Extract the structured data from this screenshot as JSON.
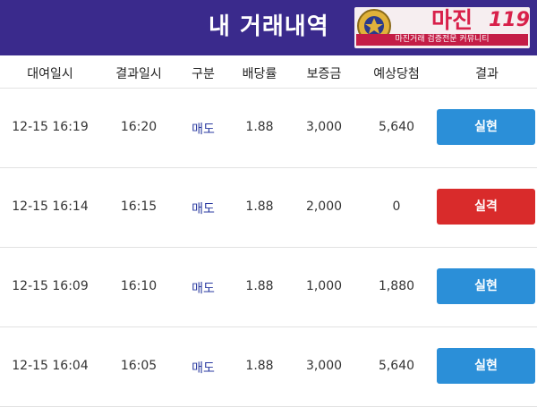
{
  "header": {
    "title": "내 거래내역",
    "logo": {
      "main": "마진",
      "number": "119",
      "tagline": "마진거래 검증전문 커뮤니티"
    }
  },
  "columns": [
    "대여일시",
    "결과일시",
    "구분",
    "배당률",
    "보증금",
    "예상당첨",
    "결과"
  ],
  "rows": [
    {
      "rent_time": "12-15 16:19",
      "result_time": "16:20",
      "type": "매도",
      "odds": "1.88",
      "deposit": "3,000",
      "expected": "5,640",
      "result": "실현",
      "status": "win"
    },
    {
      "rent_time": "12-15 16:14",
      "result_time": "16:15",
      "type": "매도",
      "odds": "1.88",
      "deposit": "2,000",
      "expected": "0",
      "result": "실격",
      "status": "lose"
    },
    {
      "rent_time": "12-15 16:09",
      "result_time": "16:10",
      "type": "매도",
      "odds": "1.88",
      "deposit": "1,000",
      "expected": "1,880",
      "result": "실현",
      "status": "win"
    },
    {
      "rent_time": "12-15 16:04",
      "result_time": "16:05",
      "type": "매도",
      "odds": "1.88",
      "deposit": "3,000",
      "expected": "5,640",
      "result": "실현",
      "status": "win"
    }
  ],
  "colors": {
    "header_bg": "#3a2a8c",
    "win": "#2b8fd8",
    "lose": "#d92b2b",
    "type_text": "#2a3aa0"
  }
}
